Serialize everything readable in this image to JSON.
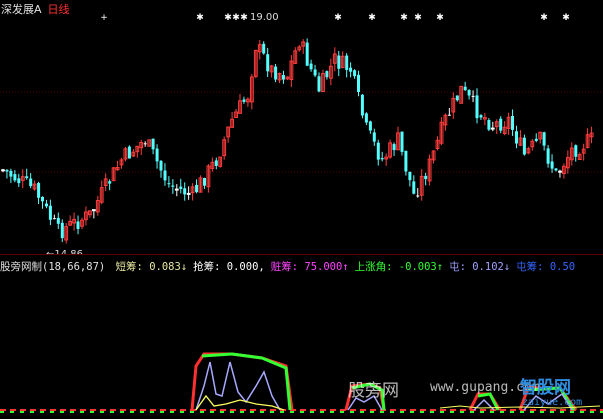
{
  "header": {
    "symbol": "深发展A",
    "period": "日线"
  },
  "main_chart": {
    "high_label": "19.00",
    "low_label": "←14.86"
  },
  "indicator": {
    "name": "股旁网制",
    "params": "(18,66,87)",
    "items": [
      {
        "label": "短筹:",
        "value": "0.083",
        "arrow": "↓",
        "color": "#e8e8a0"
      },
      {
        "label": "抢筹:",
        "value": "0.000,",
        "arrow": "",
        "color": "#ffffff"
      },
      {
        "label": "赃筹:",
        "value": "75.000",
        "arrow": "↑",
        "color": "#ff44ff"
      },
      {
        "label": "上涨角:",
        "value": "-0.003",
        "arrow": "↑",
        "color": "#33ff33"
      },
      {
        "label": "屯:",
        "value": "0.102",
        "arrow": "↓",
        "color": "#a0a0ff"
      },
      {
        "label": "屯筹:",
        "value": "0.50",
        "arrow": "",
        "color": "#3366ff"
      }
    ]
  },
  "watermarks": {
    "w1": "股旁网",
    "w2": "www.gupang.com",
    "w3": "智股网",
    "w4": "zaiyue.com"
  },
  "colors": {
    "up": "#ff3c3c",
    "down": "#54ffff",
    "flat": "#ffffff",
    "grid": "#5a0000",
    "marker": "#ffffff"
  }
}
